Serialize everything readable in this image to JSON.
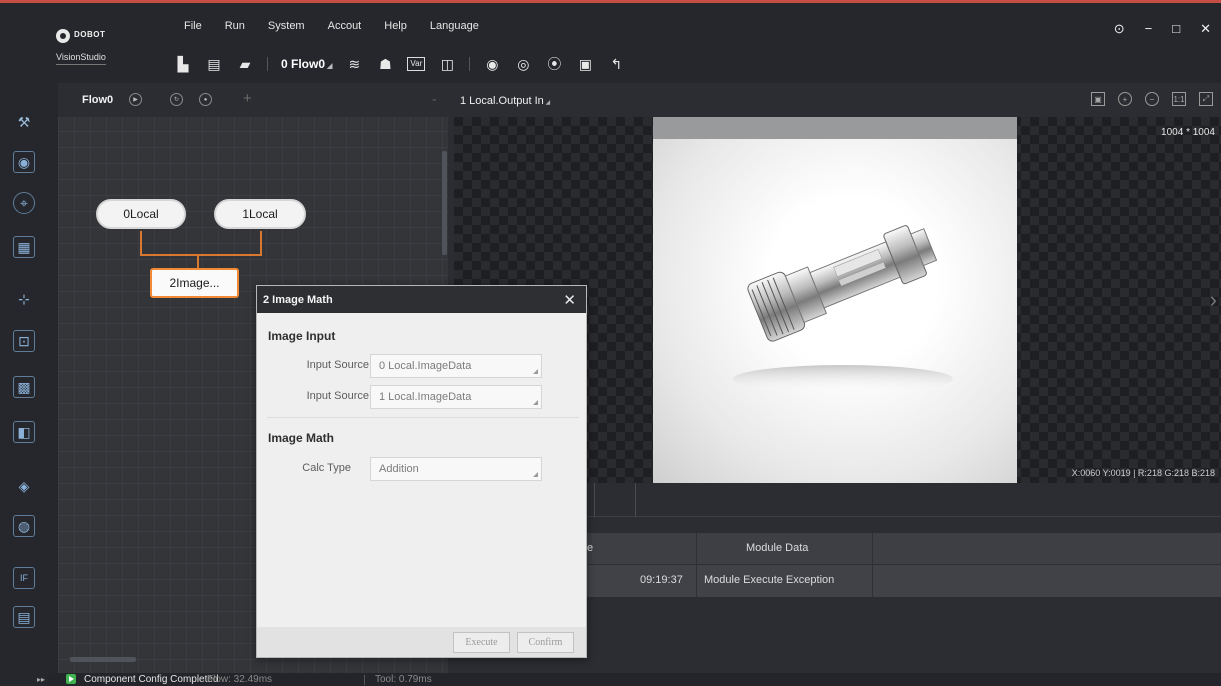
{
  "app": {
    "brand": "DOBOT",
    "product": "VisionStudio",
    "accent_color": "#c44d44"
  },
  "menu": [
    "File",
    "Run",
    "System",
    "Accout",
    "Help",
    "Language"
  ],
  "window_controls": [
    "⊙",
    "−",
    "□",
    "✕"
  ],
  "toolbar": {
    "flow_selector": "0 Flow0",
    "var_label": "Var"
  },
  "sidebar_icons": [
    "tools-icon",
    "camera-icon",
    "locate-icon",
    "measure-icon",
    "calibrate-icon",
    "recognize-icon",
    "code-icon",
    "image-process-icon",
    "color-icon",
    "defect-icon",
    "logic-icon",
    "communication-icon"
  ],
  "flow": {
    "tab": "Flow0",
    "nodes": {
      "local0": "0Local",
      "local1": "1Local",
      "image_math": "2Image..."
    }
  },
  "dialog": {
    "title": "2 Image Math",
    "section_input": "Image Input",
    "input_label_1": "Input Source",
    "input_value_1": "0 Local.ImageData",
    "input_label_2": "Input Source",
    "input_value_2": "1 Local.ImageData",
    "section_math": "Image Math",
    "calc_label": "Calc Type",
    "calc_value": "Addition",
    "execute_label": "Execute",
    "confirm_label": "Confirm"
  },
  "view": {
    "title": "1 Local.Output In",
    "dimensions": "1004 * 1004",
    "pixel_info": "X:0060 Y:0019 | R:218 G:218 B:218"
  },
  "results": {
    "col_time_fragment": "e",
    "col_module_data": "Module Data",
    "row_time_fragment": "09:19:37",
    "row_module_data": "Module Execute Exception"
  },
  "status": {
    "message": "Component Config Completed",
    "flow_time": "Flow: 32.49ms",
    "tool_time": "Tool: 0.79ms"
  }
}
